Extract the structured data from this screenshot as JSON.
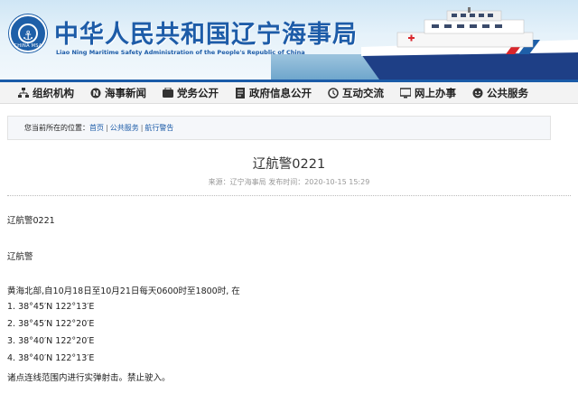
{
  "header": {
    "title_cn": "中华人民共和国辽宁海事局",
    "title_en": "Liao Ning Maritime Safety Administration of the People's Republic of China",
    "logo_text": "CHINA MSA",
    "logo_icon": "anchor-icon",
    "ship_icon": "patrol-ship-icon"
  },
  "nav": {
    "items": [
      {
        "label": "组织机构",
        "icon": "org-chart-icon"
      },
      {
        "label": "海事新闻",
        "icon": "news-icon"
      },
      {
        "label": "党务公开",
        "icon": "party-icon"
      },
      {
        "label": "政府信息公开",
        "icon": "info-icon"
      },
      {
        "label": "互动交流",
        "icon": "chat-icon"
      },
      {
        "label": "网上办事",
        "icon": "monitor-icon"
      },
      {
        "label": "公共服务",
        "icon": "service-icon"
      }
    ]
  },
  "breadcrumb": {
    "prefix": "您当前所在的位置：",
    "items": [
      "首页",
      "公共服务",
      "航行警告"
    ],
    "separator": "|"
  },
  "article": {
    "title": "辽航警0221",
    "meta": "来源：辽宁海事局   发布时间：2020-10-15 15:29",
    "lines": [
      "辽航警0221",
      "辽航警",
      "黄海北部,自10月18日至10月21日每天0600时至1800时, 在",
      "1. 38°45′N    122°13′E",
      "2. 38°45′N    122°20′E",
      "3. 38°40′N    122°20′E",
      "4. 38°40′N    122°13′E",
      "诸点连线范围内进行实弹射击。禁止驶入。"
    ]
  },
  "colors": {
    "brand": "#1d5ca8",
    "nav_bar": "#1a5ba8",
    "meta_text": "#999999"
  }
}
